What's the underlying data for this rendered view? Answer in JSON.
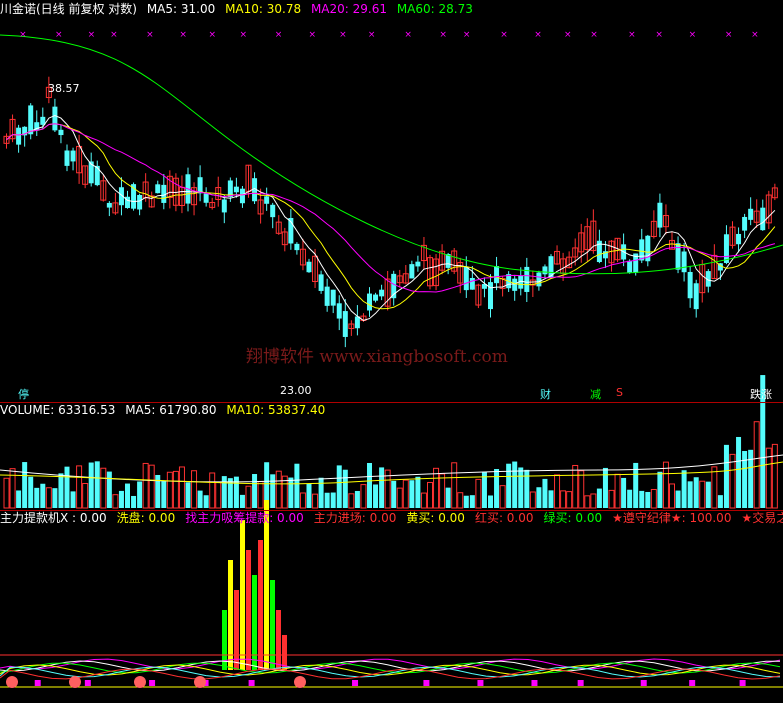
{
  "main": {
    "title": "川金诺(日线 前复权 对数)",
    "ma5_label": "MA5: 31.00",
    "ma10_label": "MA10: 30.78",
    "ma20_label": "MA20: 29.61",
    "ma60_label": "MA60: 28.73",
    "high_label": "38.57",
    "low_label": "23.00",
    "markers": {
      "ting": "停",
      "cai": "财",
      "jian": "减",
      "s": "S",
      "zhang": "跌涨"
    },
    "watermark": "翔博软件 www.xiangbosoft.com"
  },
  "volume": {
    "label": "VOLUME: 63316.53",
    "ma5_label": "MA5: 61790.80",
    "ma10_label": "MA10: 53837.40"
  },
  "indicator": {
    "items": [
      {
        "text": "主力提款机X : 0.00",
        "color": "#ffffff"
      },
      {
        "text": "洗盘: 0.00",
        "color": "#ffff00"
      },
      {
        "text": "找主力吸筹提款: 0.00",
        "color": "#ff00ff"
      },
      {
        "text": "主力进场: 0.00",
        "color": "#ff3030"
      },
      {
        "text": "黄买: 0.00",
        "color": "#ffff00"
      },
      {
        "text": "红买: 0.00",
        "color": "#ff3030"
      },
      {
        "text": "绿买: 0.00",
        "color": "#00ff00"
      },
      {
        "text": "★遵守纪律★: 100.00",
        "color": "#ff3030"
      },
      {
        "text": "★交易之道",
        "color": "#ff3030"
      }
    ]
  },
  "colors": {
    "up": "#ff3232",
    "down": "#54fcfc",
    "ma5": "#ffffff",
    "ma10": "#ffff00",
    "ma20": "#ff00ff",
    "ma60": "#00ff00",
    "grid": "#b00000"
  }
}
